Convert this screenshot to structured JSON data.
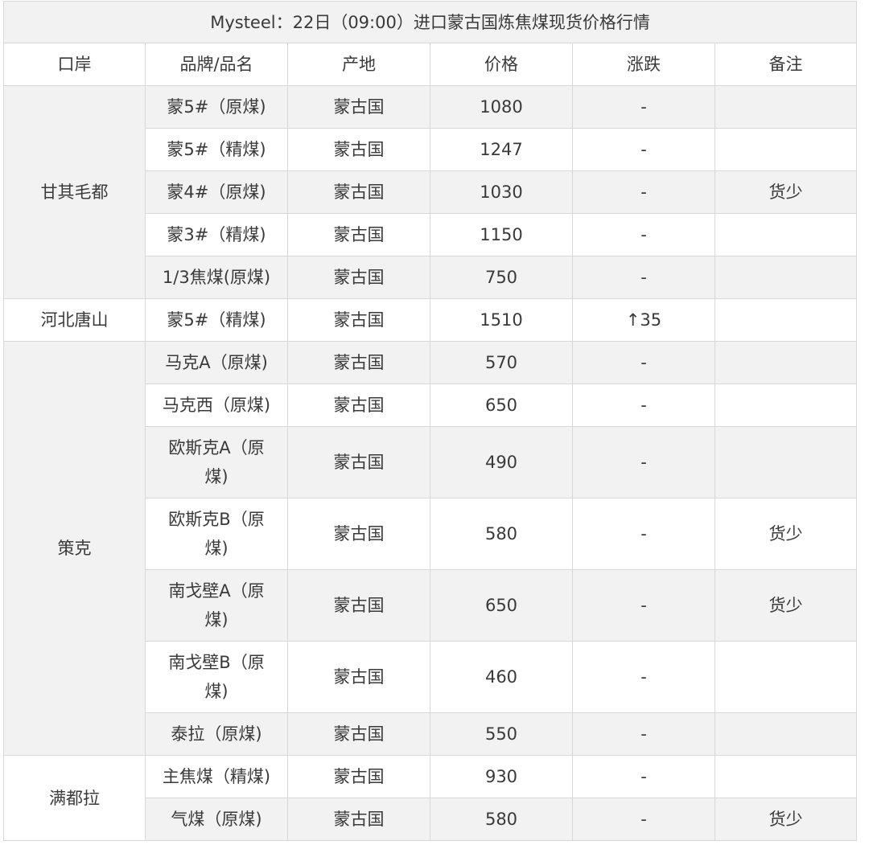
{
  "table": {
    "title": "Mysteel：22日（09:00）进口蒙古国炼焦煤现货价格行情",
    "headers": [
      "口岸",
      "品牌/品名",
      "产地",
      "价格",
      "涨跌",
      "备注"
    ],
    "groups": [
      {
        "port": "甘其毛都",
        "rows": [
          {
            "brand": "蒙5#（原煤)",
            "origin": "蒙古国",
            "price": "1080",
            "change": "-",
            "note": ""
          },
          {
            "brand": "蒙5#（精煤)",
            "origin": "蒙古国",
            "price": "1247",
            "change": "-",
            "note": ""
          },
          {
            "brand": "蒙4#（原煤)",
            "origin": "蒙古国",
            "price": "1030",
            "change": "-",
            "note": "货少"
          },
          {
            "brand": "蒙3#（精煤)",
            "origin": "蒙古国",
            "price": "1150",
            "change": "-",
            "note": ""
          },
          {
            "brand": "1/3焦煤(原煤)",
            "origin": "蒙古国",
            "price": "750",
            "change": "-",
            "note": ""
          }
        ]
      },
      {
        "port": "河北唐山",
        "rows": [
          {
            "brand": "蒙5#（精煤)",
            "origin": "蒙古国",
            "price": "1510",
            "change": "↑35",
            "note": ""
          }
        ]
      },
      {
        "port": "策克",
        "rows": [
          {
            "brand": "马克A（原煤)",
            "origin": "蒙古国",
            "price": "570",
            "change": "-",
            "note": ""
          },
          {
            "brand": "马克西（原煤)",
            "origin": "蒙古国",
            "price": "650",
            "change": "-",
            "note": ""
          },
          {
            "brand": "欧斯克A（原煤)",
            "origin": "蒙古国",
            "price": "490",
            "change": "-",
            "note": ""
          },
          {
            "brand": "欧斯克B（原煤)",
            "origin": "蒙古国",
            "price": "580",
            "change": "-",
            "note": "货少"
          },
          {
            "brand": "南戈壁A（原煤)",
            "origin": "蒙古国",
            "price": "650",
            "change": "-",
            "note": "货少"
          },
          {
            "brand": "南戈壁B（原煤)",
            "origin": "蒙古国",
            "price": "460",
            "change": "-",
            "note": ""
          },
          {
            "brand": "泰拉（原煤)",
            "origin": "蒙古国",
            "price": "550",
            "change": "-",
            "note": ""
          }
        ]
      },
      {
        "port": "满都拉",
        "rows": [
          {
            "brand": "主焦煤（精煤)",
            "origin": "蒙古国",
            "price": "930",
            "change": "-",
            "note": ""
          },
          {
            "brand": "气煤（原煤)",
            "origin": "蒙古国",
            "price": "580",
            "change": "-",
            "note": "货少"
          }
        ]
      }
    ]
  },
  "colors": {
    "up": "#c00000",
    "stripe": "#f2f2f2",
    "border": "#d8d8d8"
  }
}
